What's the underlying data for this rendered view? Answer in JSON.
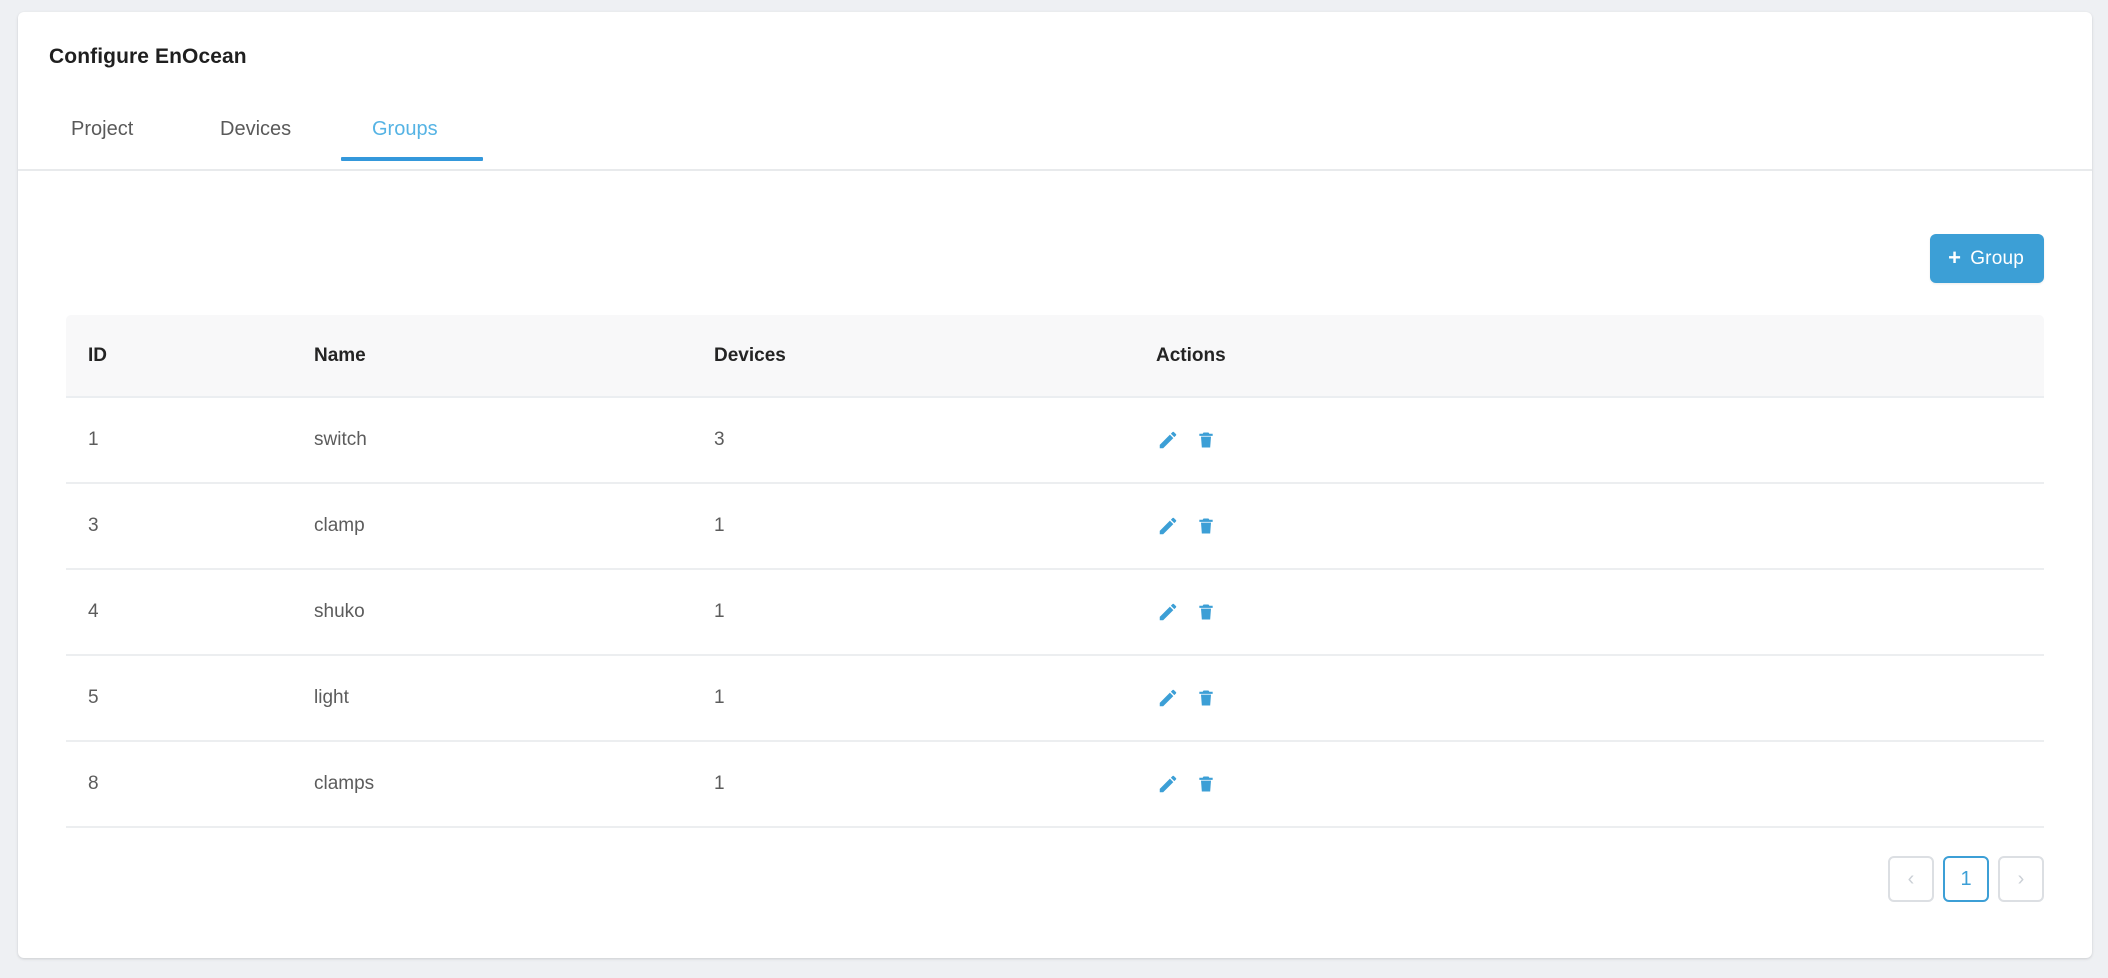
{
  "header": {
    "title": "Configure EnOcean",
    "tabs": [
      {
        "label": "Project",
        "active": false
      },
      {
        "label": "Devices",
        "active": false
      },
      {
        "label": "Groups",
        "active": true
      }
    ]
  },
  "toolbar": {
    "add_group_label": "Group",
    "add_group_plus": "+"
  },
  "table": {
    "columns": [
      "ID",
      "Name",
      "Devices",
      "Actions"
    ],
    "rows": [
      {
        "id": "1",
        "name": "switch",
        "devices": "3"
      },
      {
        "id": "3",
        "name": "clamp",
        "devices": "1"
      },
      {
        "id": "4",
        "name": "shuko",
        "devices": "1"
      },
      {
        "id": "5",
        "name": "light",
        "devices": "1"
      },
      {
        "id": "8",
        "name": "clamps",
        "devices": "1"
      }
    ],
    "row_actions": [
      "edit-icon",
      "delete-icon"
    ]
  },
  "pagination": {
    "prev_label": "‹",
    "next_label": "›",
    "pages": [
      "1"
    ],
    "current_page": "1"
  },
  "colors": {
    "accent_blue": "#3c9fd6",
    "tab_active_text": "#55b3e4",
    "icon_blue": "#3c9fd6",
    "page_background": "#eef0f3",
    "card_background": "#ffffff",
    "table_header_background": "#f8f8f9",
    "border": "#ebeef1"
  }
}
